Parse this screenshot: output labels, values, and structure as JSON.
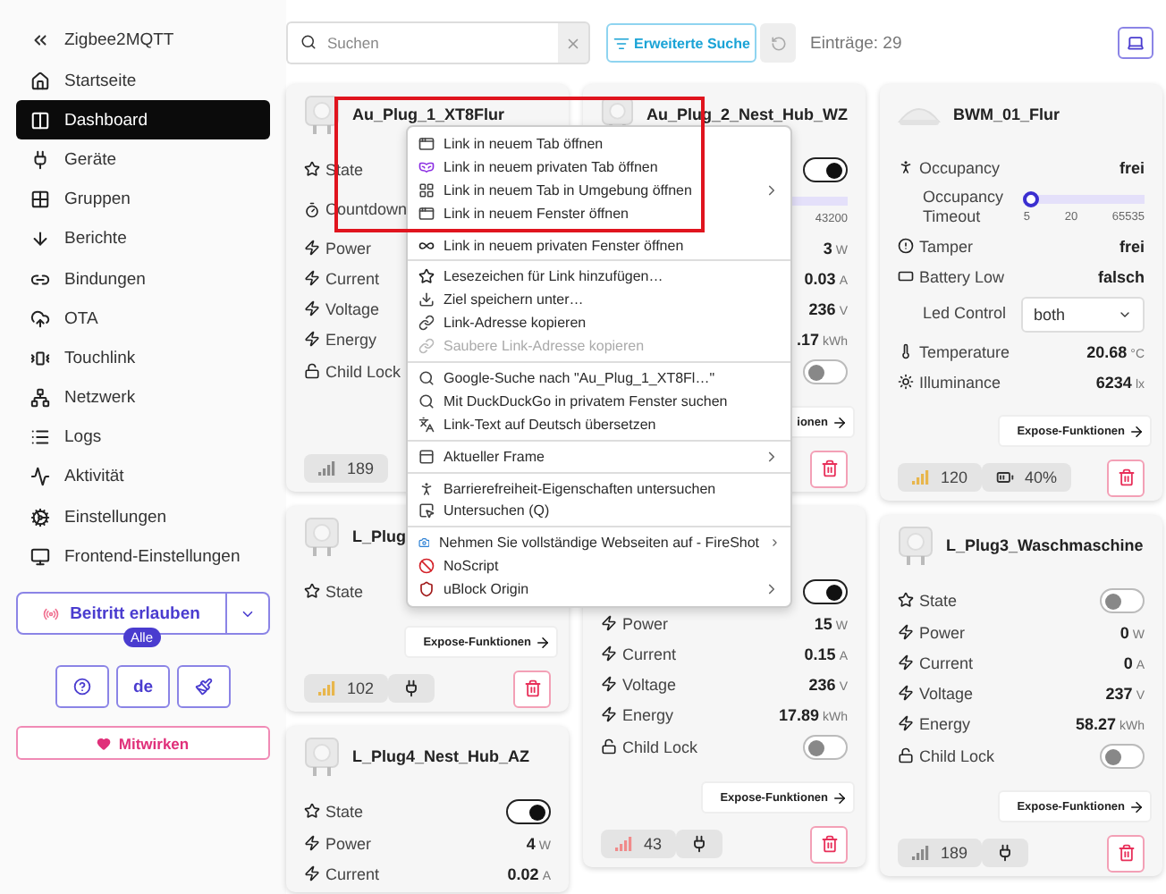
{
  "sidebar": {
    "title": "Zigbee2MQTT",
    "items": [
      {
        "label": "Startseite",
        "selected": false
      },
      {
        "label": "Dashboard",
        "selected": true
      },
      {
        "label": "Geräte",
        "selected": false
      },
      {
        "label": "Gruppen",
        "selected": false
      },
      {
        "label": "Berichte",
        "selected": false
      },
      {
        "label": "Bindungen",
        "selected": false
      },
      {
        "label": "OTA",
        "selected": false
      },
      {
        "label": "Touchlink",
        "selected": false
      },
      {
        "label": "Netzwerk",
        "selected": false
      },
      {
        "label": "Logs",
        "selected": false
      },
      {
        "label": "Aktivität",
        "selected": false
      },
      {
        "label": "Einstellungen",
        "selected": false
      },
      {
        "label": "Frontend-Einstellungen",
        "selected": false
      }
    ],
    "permit_join": {
      "label": "Beitritt erlauben",
      "badge": "Alle"
    },
    "tool_buttons": [
      {
        "kind": "help"
      },
      {
        "kind": "text",
        "label": "de"
      },
      {
        "kind": "theme"
      }
    ],
    "contribute": "Mitwirken"
  },
  "toolbar": {
    "search": {
      "placeholder": "Suchen"
    },
    "advanced_search": "Erweiterte Suche",
    "count": "Einträge: 29"
  },
  "columns": [
    [
      {
        "name": "Au_Plug_1_XT8Flur",
        "kind": "plug",
        "rows": [
          {
            "kind": "switch",
            "label": "State"
          },
          {
            "kind": "countdown",
            "label": "Countdown"
          },
          {
            "kind": "electric",
            "label": "Power"
          },
          {
            "kind": "electric",
            "label": "Current"
          },
          {
            "kind": "electric",
            "label": "Voltage"
          },
          {
            "kind": "electric",
            "label": "Energy"
          },
          {
            "kind": "lock",
            "label": "Child Lock"
          }
        ],
        "footer": {
          "lqi": {
            "text": "189",
            "color": "#8a8a8a"
          }
        }
      },
      {
        "name": "L_Plug",
        "kind": "plug",
        "rows": [
          {
            "kind": "switch",
            "label": "State"
          }
        ],
        "expose": "Expose-Funktionen",
        "footer": {
          "lqi": {
            "text": "102",
            "color": "#e8b64c"
          },
          "source": {
            "kind": "mains"
          },
          "trash": true
        }
      },
      {
        "name": "L_Plug4_Nest_Hub_AZ",
        "kind": "plug",
        "rows": [
          {
            "kind": "switch",
            "label": "State",
            "on": true
          },
          {
            "kind": "electric",
            "label": "Power",
            "value": "4",
            "unit": "W"
          },
          {
            "kind": "electric",
            "label": "Current",
            "value": "0.02",
            "unit": "A"
          }
        ]
      }
    ],
    [
      {
        "name": "Au_Plug_2_Nest_Hub_WZ",
        "kind": "plug",
        "rows": [
          {
            "kind": "switch",
            "on": true
          },
          {
            "kind": "countdown",
            "ticks": [
              "43200"
            ]
          },
          {
            "kind": "electric",
            "value": "3",
            "unit": "W"
          },
          {
            "kind": "electric",
            "value": "0.03",
            "unit": "A"
          },
          {
            "kind": "electric",
            "value": "236",
            "unit": "V"
          },
          {
            "kind": "electric",
            "value": ".17",
            "unit": "kWh"
          },
          {
            "kind": "lock",
            "on": false
          }
        ],
        "expose": "ionen",
        "footer": {
          "trash": true
        }
      },
      {
        "rows": [
          {
            "kind": "switch",
            "on": true
          },
          {
            "kind": "electric",
            "label": "Power",
            "value": "15",
            "unit": "W"
          },
          {
            "kind": "electric",
            "label": "Current",
            "value": "0.15",
            "unit": "A"
          },
          {
            "kind": "electric",
            "label": "Voltage",
            "value": "236",
            "unit": "V"
          },
          {
            "kind": "electric",
            "label": "Energy",
            "value": "17.89",
            "unit": "kWh"
          },
          {
            "kind": "lock",
            "label": "Child Lock",
            "on": false
          }
        ],
        "expose": "Expose-Funktionen",
        "footer": {
          "lqi": {
            "text": "43",
            "color": "#f08a8a"
          },
          "source": {
            "kind": "mains"
          },
          "trash": true
        }
      }
    ],
    [
      {
        "name": "BWM_01_Flur",
        "kind": "sensor",
        "rows": [
          {
            "kind": "occupancy",
            "label": "Occupancy",
            "value": "frei"
          },
          {
            "kind": "timeout",
            "label": "Occupancy Timeout",
            "level": 0,
            "ticks": [
              "5",
              "20",
              "65535"
            ]
          },
          {
            "kind": "tamper",
            "label": "Tamper",
            "value": "frei"
          },
          {
            "kind": "battery_low",
            "label": "Battery Low",
            "value": "falsch"
          },
          {
            "kind": "select",
            "label": "Led Control",
            "value": "both"
          },
          {
            "kind": "temperature",
            "label": "Temperature",
            "value": "20.68",
            "unit": "°C"
          },
          {
            "kind": "illuminance",
            "label": "Illuminance",
            "value": "6234",
            "unit": "lx"
          }
        ],
        "expose": "Expose-Funktionen",
        "footer": {
          "lqi": {
            "text": "120",
            "color": "#e8b64c"
          },
          "source": {
            "kind": "battery",
            "text": "40%"
          },
          "trash": true
        }
      },
      {
        "name": "L_Plug3_Waschmaschine",
        "kind": "plug",
        "rows": [
          {
            "kind": "switch",
            "label": "State",
            "on": false
          },
          {
            "kind": "electric",
            "label": "Power",
            "value": "0",
            "unit": "W"
          },
          {
            "kind": "electric",
            "label": "Current",
            "value": "0",
            "unit": "A"
          },
          {
            "kind": "electric",
            "label": "Voltage",
            "value": "237",
            "unit": "V"
          },
          {
            "kind": "electric",
            "label": "Energy",
            "value": "58.27",
            "unit": "kWh"
          },
          {
            "kind": "lock",
            "label": "Child Lock",
            "on": false
          }
        ],
        "expose": "Expose-Funktionen",
        "footer": {
          "lqi": {
            "text": "189",
            "color": "#8a8a8a"
          },
          "source": {
            "kind": "mains"
          },
          "trash": true
        }
      }
    ]
  ],
  "context_menu": {
    "groups": [
      [
        {
          "label": "Link in neuem Tab öffnen",
          "submenu": false,
          "disabled": false
        },
        {
          "label": "Link in neuem privaten Tab öffnen",
          "submenu": false,
          "disabled": false
        },
        {
          "label": "Link in neuem Tab in Umgebung öffnen",
          "submenu": true,
          "disabled": false
        },
        {
          "label": "Link in neuem Fenster öffnen",
          "submenu": false,
          "disabled": false
        },
        {
          "label": "Link in neuem privaten Fenster öffnen",
          "submenu": false,
          "disabled": false
        }
      ],
      [
        {
          "label": "Lesezeichen für Link hinzufügen…",
          "submenu": false,
          "disabled": false
        },
        {
          "label": "Ziel speichern unter…",
          "submenu": false,
          "disabled": false
        },
        {
          "label": "Link-Adresse kopieren",
          "submenu": false,
          "disabled": false
        },
        {
          "label": "Saubere Link-Adresse kopieren",
          "submenu": false,
          "disabled": true
        }
      ],
      [
        {
          "label": "Google-Suche nach \"Au_Plug_1_XT8Fl…\"",
          "submenu": false,
          "disabled": false
        },
        {
          "label": "Mit DuckDuckGo in privatem Fenster suchen",
          "submenu": false,
          "disabled": false
        },
        {
          "label": "Link-Text auf Deutsch übersetzen",
          "submenu": false,
          "disabled": false
        }
      ],
      [
        {
          "label": "Aktueller Frame",
          "submenu": true,
          "disabled": false
        }
      ],
      [
        {
          "label": "Barrierefreiheit-Eigenschaften untersuchen",
          "submenu": false,
          "disabled": false
        },
        {
          "label": "Untersuchen (Q)",
          "submenu": false,
          "disabled": false
        }
      ],
      [
        {
          "label": "Nehmen Sie vollständige Webseiten auf - FireShot",
          "submenu": true,
          "disabled": false
        },
        {
          "label": "NoScript",
          "submenu": false,
          "disabled": false
        },
        {
          "label": "uBlock Origin",
          "submenu": true,
          "disabled": false
        }
      ]
    ],
    "highlight_frame": true
  }
}
